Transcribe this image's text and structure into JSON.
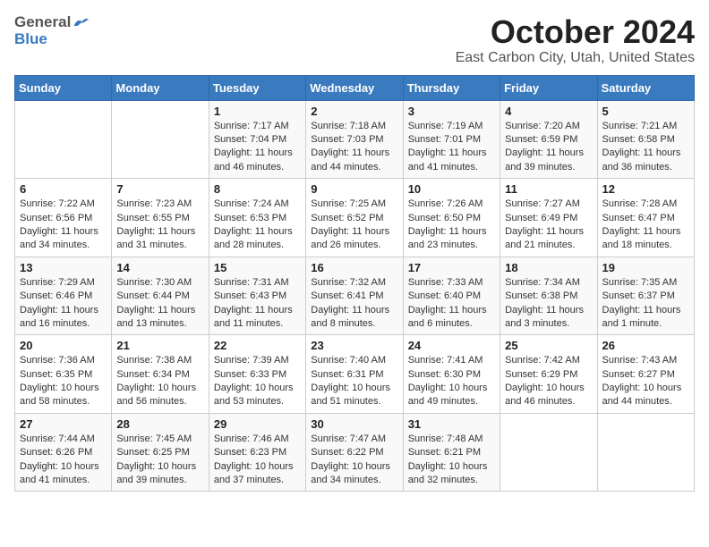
{
  "header": {
    "logo_general": "General",
    "logo_blue": "Blue",
    "title": "October 2024",
    "subtitle": "East Carbon City, Utah, United States"
  },
  "weekdays": [
    "Sunday",
    "Monday",
    "Tuesday",
    "Wednesday",
    "Thursday",
    "Friday",
    "Saturday"
  ],
  "weeks": [
    [
      {
        "day": "",
        "info": ""
      },
      {
        "day": "",
        "info": ""
      },
      {
        "day": "1",
        "info": "Sunrise: 7:17 AM\nSunset: 7:04 PM\nDaylight: 11 hours and 46 minutes."
      },
      {
        "day": "2",
        "info": "Sunrise: 7:18 AM\nSunset: 7:03 PM\nDaylight: 11 hours and 44 minutes."
      },
      {
        "day": "3",
        "info": "Sunrise: 7:19 AM\nSunset: 7:01 PM\nDaylight: 11 hours and 41 minutes."
      },
      {
        "day": "4",
        "info": "Sunrise: 7:20 AM\nSunset: 6:59 PM\nDaylight: 11 hours and 39 minutes."
      },
      {
        "day": "5",
        "info": "Sunrise: 7:21 AM\nSunset: 6:58 PM\nDaylight: 11 hours and 36 minutes."
      }
    ],
    [
      {
        "day": "6",
        "info": "Sunrise: 7:22 AM\nSunset: 6:56 PM\nDaylight: 11 hours and 34 minutes."
      },
      {
        "day": "7",
        "info": "Sunrise: 7:23 AM\nSunset: 6:55 PM\nDaylight: 11 hours and 31 minutes."
      },
      {
        "day": "8",
        "info": "Sunrise: 7:24 AM\nSunset: 6:53 PM\nDaylight: 11 hours and 28 minutes."
      },
      {
        "day": "9",
        "info": "Sunrise: 7:25 AM\nSunset: 6:52 PM\nDaylight: 11 hours and 26 minutes."
      },
      {
        "day": "10",
        "info": "Sunrise: 7:26 AM\nSunset: 6:50 PM\nDaylight: 11 hours and 23 minutes."
      },
      {
        "day": "11",
        "info": "Sunrise: 7:27 AM\nSunset: 6:49 PM\nDaylight: 11 hours and 21 minutes."
      },
      {
        "day": "12",
        "info": "Sunrise: 7:28 AM\nSunset: 6:47 PM\nDaylight: 11 hours and 18 minutes."
      }
    ],
    [
      {
        "day": "13",
        "info": "Sunrise: 7:29 AM\nSunset: 6:46 PM\nDaylight: 11 hours and 16 minutes."
      },
      {
        "day": "14",
        "info": "Sunrise: 7:30 AM\nSunset: 6:44 PM\nDaylight: 11 hours and 13 minutes."
      },
      {
        "day": "15",
        "info": "Sunrise: 7:31 AM\nSunset: 6:43 PM\nDaylight: 11 hours and 11 minutes."
      },
      {
        "day": "16",
        "info": "Sunrise: 7:32 AM\nSunset: 6:41 PM\nDaylight: 11 hours and 8 minutes."
      },
      {
        "day": "17",
        "info": "Sunrise: 7:33 AM\nSunset: 6:40 PM\nDaylight: 11 hours and 6 minutes."
      },
      {
        "day": "18",
        "info": "Sunrise: 7:34 AM\nSunset: 6:38 PM\nDaylight: 11 hours and 3 minutes."
      },
      {
        "day": "19",
        "info": "Sunrise: 7:35 AM\nSunset: 6:37 PM\nDaylight: 11 hours and 1 minute."
      }
    ],
    [
      {
        "day": "20",
        "info": "Sunrise: 7:36 AM\nSunset: 6:35 PM\nDaylight: 10 hours and 58 minutes."
      },
      {
        "day": "21",
        "info": "Sunrise: 7:38 AM\nSunset: 6:34 PM\nDaylight: 10 hours and 56 minutes."
      },
      {
        "day": "22",
        "info": "Sunrise: 7:39 AM\nSunset: 6:33 PM\nDaylight: 10 hours and 53 minutes."
      },
      {
        "day": "23",
        "info": "Sunrise: 7:40 AM\nSunset: 6:31 PM\nDaylight: 10 hours and 51 minutes."
      },
      {
        "day": "24",
        "info": "Sunrise: 7:41 AM\nSunset: 6:30 PM\nDaylight: 10 hours and 49 minutes."
      },
      {
        "day": "25",
        "info": "Sunrise: 7:42 AM\nSunset: 6:29 PM\nDaylight: 10 hours and 46 minutes."
      },
      {
        "day": "26",
        "info": "Sunrise: 7:43 AM\nSunset: 6:27 PM\nDaylight: 10 hours and 44 minutes."
      }
    ],
    [
      {
        "day": "27",
        "info": "Sunrise: 7:44 AM\nSunset: 6:26 PM\nDaylight: 10 hours and 41 minutes."
      },
      {
        "day": "28",
        "info": "Sunrise: 7:45 AM\nSunset: 6:25 PM\nDaylight: 10 hours and 39 minutes."
      },
      {
        "day": "29",
        "info": "Sunrise: 7:46 AM\nSunset: 6:23 PM\nDaylight: 10 hours and 37 minutes."
      },
      {
        "day": "30",
        "info": "Sunrise: 7:47 AM\nSunset: 6:22 PM\nDaylight: 10 hours and 34 minutes."
      },
      {
        "day": "31",
        "info": "Sunrise: 7:48 AM\nSunset: 6:21 PM\nDaylight: 10 hours and 32 minutes."
      },
      {
        "day": "",
        "info": ""
      },
      {
        "day": "",
        "info": ""
      }
    ]
  ]
}
